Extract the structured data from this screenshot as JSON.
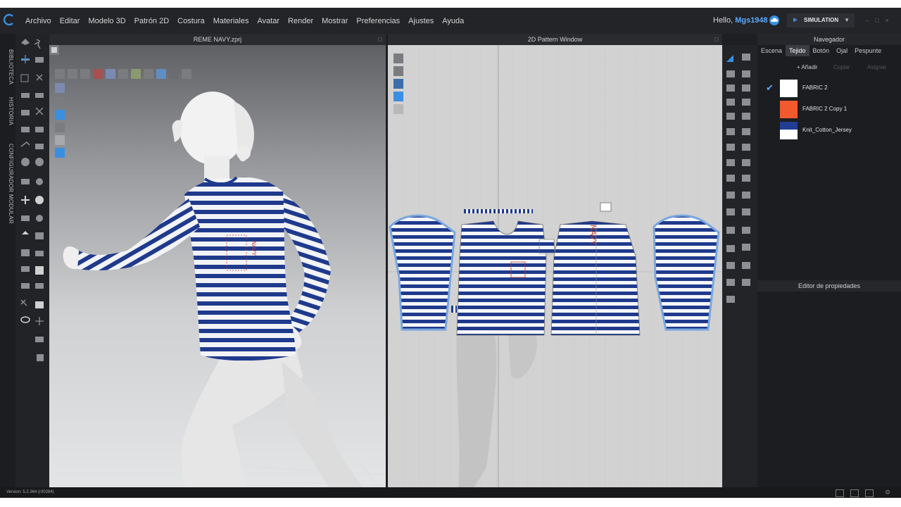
{
  "menu": {
    "items": [
      "Archivo",
      "Editar",
      "Modelo 3D",
      "Patrón 2D",
      "Costura",
      "Materiales",
      "Avatar",
      "Render",
      "Mostrar",
      "Preferencias",
      "Ajustes",
      "Ayuda"
    ],
    "greeting": "Hello,",
    "username": "Mgs1948",
    "mode_label": "SIMULATION"
  },
  "left_tabs": [
    "BIBLIOTECA",
    "HISTORIA",
    "CONFIGURADOR MODULAR"
  ],
  "window3d": {
    "title": "REME NAVY.zprj"
  },
  "window2d": {
    "title": "2D Pattern Window"
  },
  "navigator": {
    "title": "Navegador",
    "tabs": [
      "Escena",
      "Tejido",
      "Botón",
      "Ojal",
      "Pespunte"
    ],
    "active_tab": "Tejido",
    "buttons": {
      "add": "+ Añadir",
      "copy": "Copiar",
      "delete": "Asignar"
    },
    "fabrics": [
      {
        "name": "FABRIC 2",
        "color": "#ffffff",
        "selected": true
      },
      {
        "name": "FABRIC 2 Copy 1",
        "color": "#f05a2c",
        "selected": false
      },
      {
        "name": "Knit_Cotton_Jersey",
        "color": "#1f3e94",
        "selected": false
      }
    ]
  },
  "properties": {
    "title": "Editor de propiedades"
  },
  "status": {
    "version": "Version: 5.2.364 (r30284)"
  },
  "colors": {
    "accent": "#5aa8ff",
    "navy_stripe": "#1f3a8c",
    "orange": "#f05a2c"
  }
}
